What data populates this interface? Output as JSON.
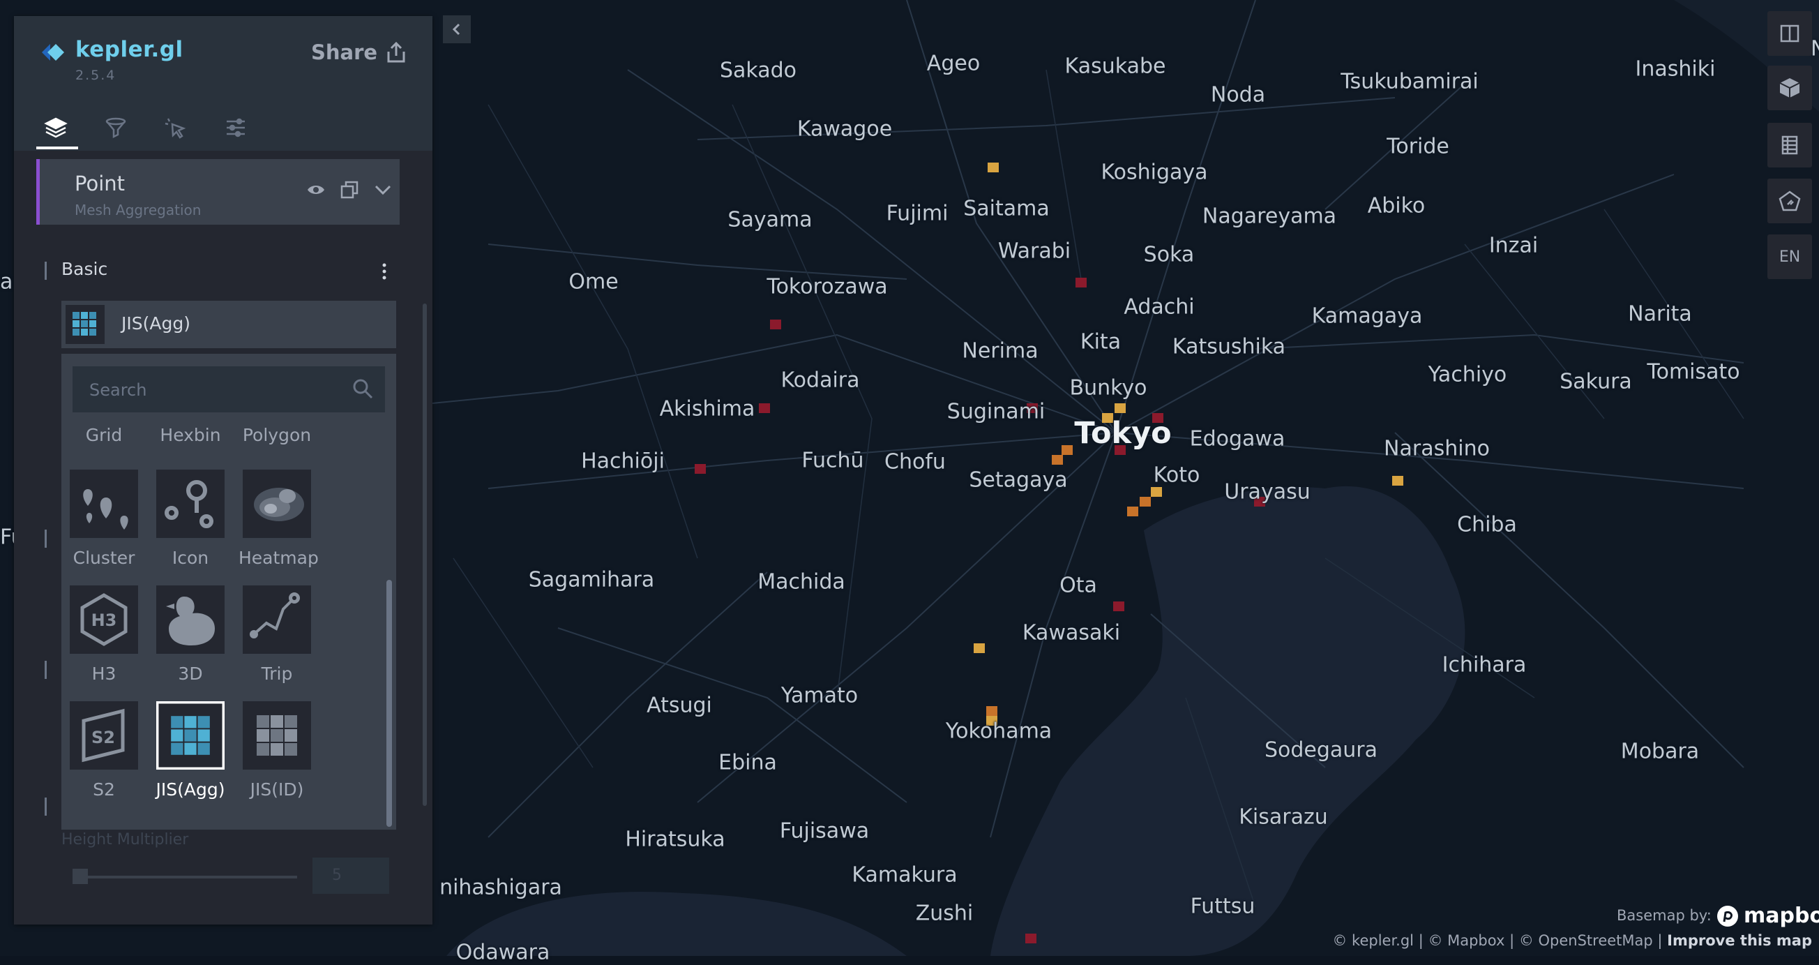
{
  "app": {
    "name": "kepler.gl",
    "version": "2.5.4",
    "share_label": "Share"
  },
  "tabs": [
    {
      "name": "layers",
      "icon": "layers-icon"
    },
    {
      "name": "filters",
      "icon": "filter-icon"
    },
    {
      "name": "interactions",
      "icon": "cursor-click-icon"
    },
    {
      "name": "base-map",
      "icon": "sliders-icon"
    }
  ],
  "layer": {
    "title": "Point",
    "subtitle": "Mesh Aggregation"
  },
  "basic_section": {
    "label": "Basic"
  },
  "layer_type": {
    "selected": "JIS(Agg)",
    "search_placeholder": "Search",
    "top_row_labels": [
      "Grid",
      "Hexbin",
      "Polygon"
    ],
    "types": [
      {
        "label": "Cluster",
        "icon": "cluster-icon"
      },
      {
        "label": "Icon",
        "icon": "icon-layer-icon"
      },
      {
        "label": "Heatmap",
        "icon": "heatmap-icon"
      },
      {
        "label": "H3",
        "icon": "h3-icon"
      },
      {
        "label": "3D",
        "icon": "duck-3d-icon"
      },
      {
        "label": "Trip",
        "icon": "trip-icon"
      },
      {
        "label": "S2",
        "icon": "s2-icon"
      },
      {
        "label": "JIS(Agg)",
        "icon": "jis-agg-icon",
        "selected": true
      },
      {
        "label": "JIS(ID)",
        "icon": "jis-id-icon"
      }
    ]
  },
  "height_multiplier": {
    "label": "Height Multiplier",
    "value": "5"
  },
  "map_controls": {
    "lang_label": "EN"
  },
  "places": [
    "Sakado",
    "Ageo",
    "Kasukabe",
    "Noda",
    "Tsukubamirai",
    "Inashiki",
    "Kawagoe",
    "Toride",
    "Koshigaya",
    "Saitama",
    "Fujimi",
    "Sayama",
    "Nagareyama",
    "Abiko",
    "Warabi",
    "Soka",
    "Inzai",
    "Ome",
    "Tokorozawa",
    "Adachi",
    "Kamagaya",
    "Narita",
    "Kita",
    "Nerima",
    "Katsushika",
    "Kodaira",
    "Yachiyo",
    "Sakura",
    "Tomisato",
    "Bunkyo",
    "Akishima",
    "Suginami",
    "Tokyo",
    "Edogawa",
    "Narashino",
    "Hachiōji",
    "Fuchū",
    "Chofu",
    "Setagaya",
    "Koto",
    "Urayasu",
    "Chiba",
    "Sagamihara",
    "Machida",
    "Ota",
    "Kawasaki",
    "Ichihara",
    "Atsugi",
    "Yamato",
    "Yokohama",
    "Sodegaura",
    "Mobara",
    "Ebina",
    "Kisarazu",
    "Hiratsuka",
    "Fujisawa",
    "Kamakura",
    "Zushi",
    "Futtsu",
    "nihashigara",
    "Odawara"
  ],
  "partial_labels": [
    "N",
    "a",
    "Fu"
  ],
  "attribution": {
    "basemap_by": "Basemap by:",
    "mapbox": "mapbox",
    "text": "© kepler.gl | © Mapbox | © OpenStreetMap |",
    "improve": "Improve this map"
  },
  "colors": {
    "accent": "#6fcfec",
    "layer_bar": "#8a4fd0",
    "cell_high": "#8b1a2c",
    "cell_mid": "#c8732a",
    "cell_low": "#d9a441"
  }
}
